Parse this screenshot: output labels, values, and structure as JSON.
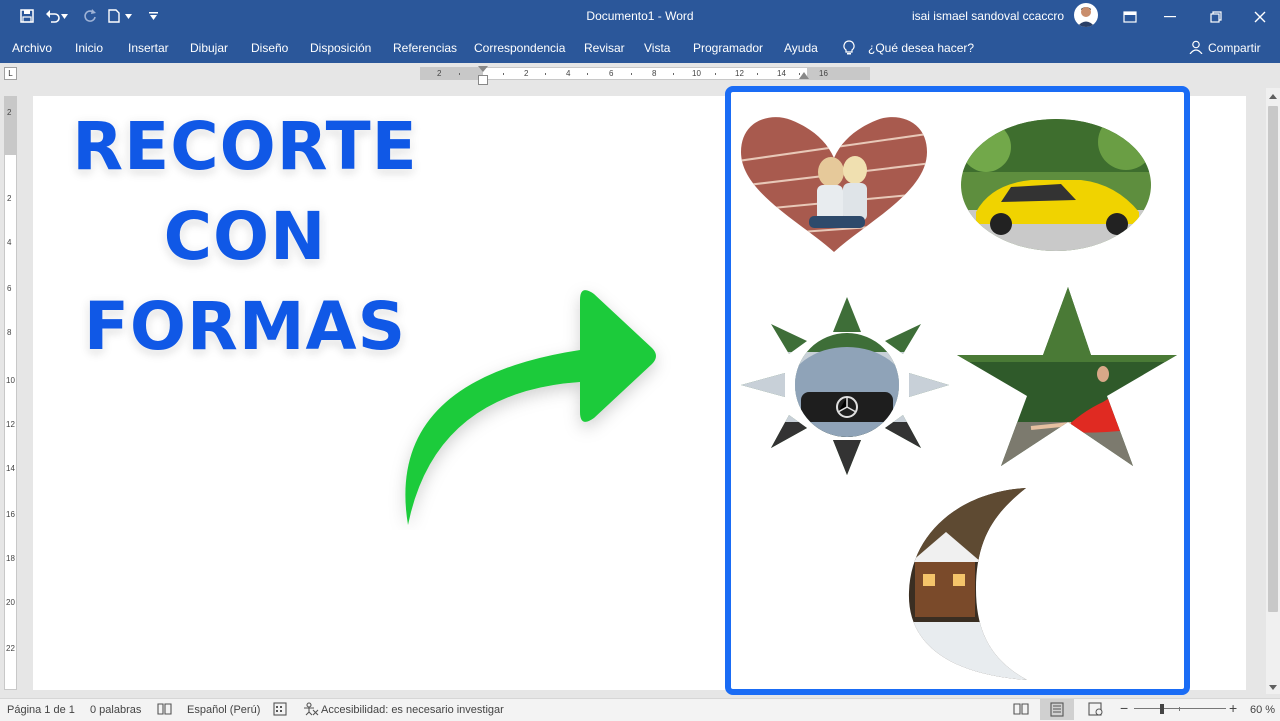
{
  "titlebar": {
    "document_title": "Documento1  -  Word",
    "user_name": "isai ismael sandoval ccaccro",
    "icons": [
      "save-icon",
      "undo-icon",
      "redo-icon",
      "new-document-icon",
      "customize-toolbar-icon",
      "ribbon-display-options-icon",
      "minimize-icon",
      "restore-icon",
      "close-icon"
    ]
  },
  "ribbon": {
    "tabs": [
      "Archivo",
      "Inicio",
      "Insertar",
      "Dibujar",
      "Diseño",
      "Disposición",
      "Referencias",
      "Correspondencia",
      "Revisar",
      "Vista",
      "Programador",
      "Ayuda"
    ],
    "tell_me": "¿Qué desea hacer?",
    "share": "Compartir",
    "colors": {
      "ribbon": "#2b579a"
    }
  },
  "ruler": {
    "horizontal_labels": [
      "2",
      "2",
      "4",
      "6",
      "8",
      "10",
      "12",
      "14",
      "16"
    ],
    "vertical_labels": [
      "2",
      "2",
      "4",
      "6",
      "8",
      "10",
      "12",
      "14",
      "16",
      "18",
      "20",
      "22"
    ],
    "corner_glyph": "L"
  },
  "document": {
    "title_lines": [
      "RECORTE",
      "CON",
      "FORMAS"
    ],
    "title_color": "#1058e6",
    "arrow_color": "#1ecb3a",
    "frame_color": "#1a6cf5",
    "shapes": [
      {
        "shape": "heart",
        "picture": "two-girls-on-running-track"
      },
      {
        "shape": "oval",
        "picture": "yellow-sports-car"
      },
      {
        "shape": "sun",
        "picture": "car-front-grille"
      },
      {
        "shape": "star",
        "picture": "woman-in-red-dress-in-forest"
      },
      {
        "shape": "moon",
        "picture": "cabin-in-snowy-forest"
      }
    ]
  },
  "statusbar": {
    "page": "Página 1 de 1",
    "words": "0 palabras",
    "language": "Español (Perú)",
    "accessibility": "Accesibilidad: es necesario investigar",
    "zoom": "60 %"
  }
}
